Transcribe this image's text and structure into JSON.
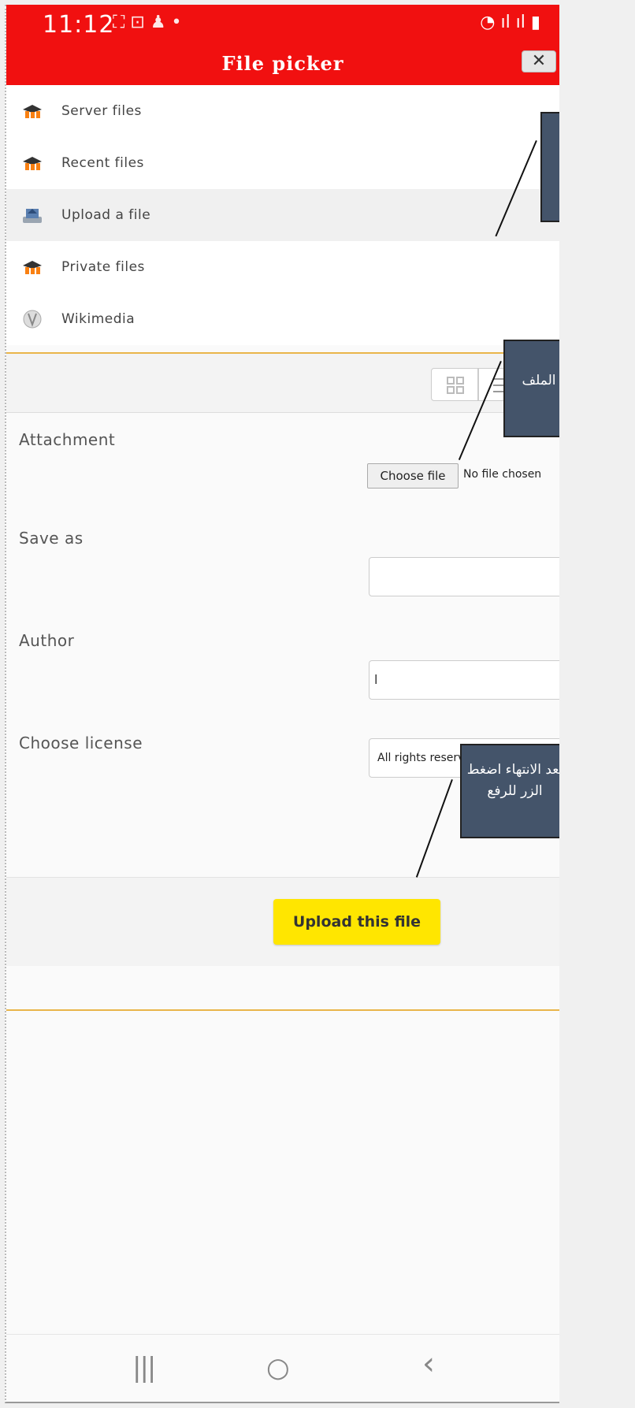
{
  "status_bar": {
    "time": "11:12",
    "left_icons": "⛶ ⊡ ♟ •",
    "right_icons": "◔ ıl ıl ▮"
  },
  "header": {
    "title": "File picker",
    "close_label": "✕"
  },
  "repositories": [
    {
      "label": "Server files",
      "icon": "moodle-icon"
    },
    {
      "label": "Recent files",
      "icon": "moodle-icon"
    },
    {
      "label": "Upload a file",
      "icon": "upload-icon",
      "active": true
    },
    {
      "label": "Private files",
      "icon": "moodle-icon"
    },
    {
      "label": "Wikimedia",
      "icon": "wikimedia-icon"
    }
  ],
  "form": {
    "attachment_label": "Attachment",
    "choose_file_label": "Choose file",
    "no_file_text": "No file chosen",
    "save_as_label": "Save as",
    "save_as_value": "",
    "author_label": "Author",
    "author_value": "ا",
    "license_label": "Choose license",
    "license_value": "All rights reserved",
    "upload_button_label": "Upload this file"
  },
  "callouts": {
    "top": "",
    "middle": "الملف",
    "bottom": "بعد الانتهاء اضغط الزر للرفع"
  },
  "nav_bar": {
    "recents": "|||",
    "home": "○",
    "back": "‹"
  },
  "colors": {
    "header_bg": "#f11010",
    "upload_button_bg": "#ffe600",
    "divider": "#e9b54a",
    "callout_bg": "#44546a"
  }
}
